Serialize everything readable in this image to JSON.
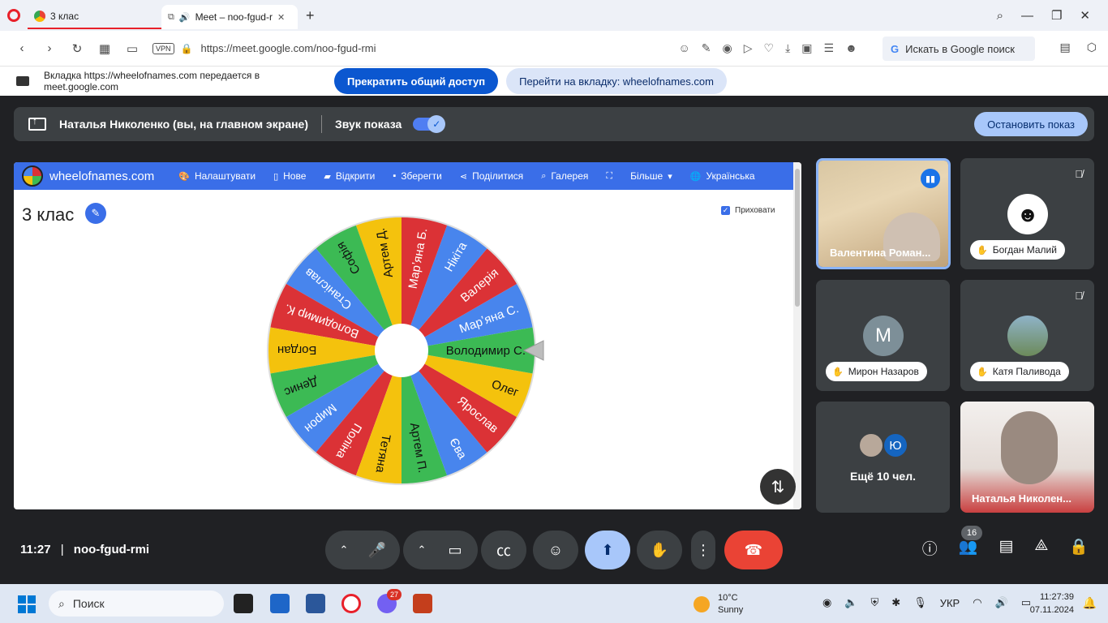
{
  "browser": {
    "tabs": [
      {
        "title": "3 клас"
      },
      {
        "title": "Meet – noo-fgud-r"
      }
    ],
    "url": "https://meet.google.com/noo-fgud-rmi",
    "vpn_label": "VPN",
    "search_placeholder": "Искать в Google поиск"
  },
  "share_bar": {
    "message": "Вкладка https://wheelofnames.com передается в meet.google.com",
    "stop_label": "Прекратить общий доступ",
    "goto_label": "Перейти на вкладку: wheelofnames.com"
  },
  "presenting": {
    "name": "Наталья Николенко (вы, на главном экране)",
    "sound_label": "Звук показа",
    "stop_label": "Остановить показ"
  },
  "wheel_site": {
    "brand": "wheelofnames.com",
    "menu": [
      "Налаштувати",
      "Нове",
      "Відкрити",
      "Зберегти",
      "Поділитися",
      "Галерея",
      "",
      "Більше",
      "Українська"
    ],
    "title": "3 клас",
    "hide_label": "Приховати",
    "names": [
      "Марʼяна С.",
      "Валерія",
      "Нікіта",
      "Марʼяна Б.",
      "Артем Д.",
      "Софія",
      "Станіслав",
      "Володимир К.",
      "Богдан",
      "Денис",
      "Мирон",
      "Поліна",
      "Тетяна",
      "Артем П.",
      "Єва",
      "Ярослав",
      "Олег",
      "Володимир С."
    ],
    "colors": [
      "#4885ed",
      "#db3236",
      "#4885ed",
      "#db3236",
      "#f4c20d",
      "#3cba54",
      "#4885ed",
      "#db3236",
      "#f4c20d",
      "#3cba54",
      "#4885ed",
      "#db3236",
      "#f4c20d",
      "#3cba54",
      "#4885ed",
      "#db3236",
      "#f4c20d",
      "#3cba54"
    ]
  },
  "participants": [
    {
      "name": "Валентина Роман...",
      "speaking": true
    },
    {
      "name": "Богдан Малий",
      "muted": true
    },
    {
      "name": "Мирон Назаров",
      "initial": "М",
      "color": "#7d8f98"
    },
    {
      "name": "Катя Паливода",
      "muted": true
    },
    {
      "more_text": "Ещё 10 чел.",
      "initial": "Ю",
      "color": "#1565c0"
    },
    {
      "name": "Наталья Николен..."
    }
  ],
  "meeting": {
    "time": "11:27",
    "code": "noo-fgud-rmi",
    "people_count": "16"
  },
  "taskbar": {
    "search_label": "Поиск",
    "viber_badge": "27",
    "weather_temp": "10°C",
    "weather_desc": "Sunny",
    "lang": "УКР",
    "time": "11:27:39",
    "date": "07.11.2024"
  }
}
